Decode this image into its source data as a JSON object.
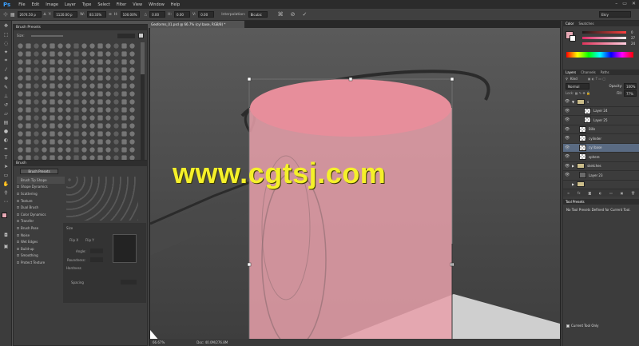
{
  "app": {
    "logo": "Ps"
  },
  "menu": {
    "items": [
      "File",
      "Edit",
      "Image",
      "Layer",
      "Type",
      "Select",
      "Filter",
      "View",
      "Window",
      "Help"
    ]
  },
  "window_controls": [
    "–",
    "▭",
    "✕"
  ],
  "options_bar": {
    "x_value": "2674.50 p",
    "y_label": "Y:",
    "y_value": "1120.00 p",
    "w_label": "W:",
    "w_value": "83.33%",
    "h_label": "H:",
    "h_value": "100.00%",
    "angle_value": "0.00",
    "hskew_label": "H:",
    "hskew_value": "0.00",
    "vskew_label": "V:",
    "vskew_value": "0.00",
    "interp_label": "Interpolation:",
    "interp_value": "Bicubic",
    "workspace": "Ekry"
  },
  "brush_presets": {
    "title": "Brush Presets",
    "size_label": "Size:"
  },
  "brush_panel": {
    "tab": "Brush",
    "presets_button": "Brush Presets",
    "items": [
      "Brush Tip Shape",
      "Shape Dynamics",
      "Scattering",
      "Texture",
      "Dual Brush",
      "Color Dynamics",
      "Transfer",
      "Brush Pose",
      "Noise",
      "Wet Edges",
      "Build-up",
      "Smoothing",
      "Protect Texture"
    ],
    "size_label": "Size",
    "flipx": "Flip X",
    "flipy": "Flip Y",
    "angle": "Angle:",
    "roundness": "Roundness:",
    "hardness": "Hardness",
    "spacing": "Spacing"
  },
  "document": {
    "tab": "Geoforms_01.psd @ 66.7% (cyl base, RGB/8) *",
    "zoom": "66.67%",
    "doc_info": "Doc: 40.0M/276.8M"
  },
  "watermark": "www.cgtsj.com",
  "color_panel": {
    "tabs": [
      "Color",
      "Swatches"
    ],
    "values": [
      "0",
      "27",
      "24"
    ]
  },
  "layers_panel": {
    "tabs": [
      "Layers",
      "Channels",
      "Paths"
    ],
    "kind_label": "Kind",
    "blend_mode": "Normal",
    "opacity_label": "Opacity:",
    "opacity_value": "100%",
    "fill_label": "Fill:",
    "fill_value": "77%",
    "layers": [
      {
        "name": "s",
        "type": "group"
      },
      {
        "name": "Layer 24",
        "type": "layer"
      },
      {
        "name": "Layer 25",
        "type": "layer"
      },
      {
        "name": "Bills",
        "type": "layer"
      },
      {
        "name": "cylinder",
        "type": "layer"
      },
      {
        "name": "cyl base",
        "type": "layer",
        "selected": true
      },
      {
        "name": "sphere",
        "type": "layer"
      },
      {
        "name": "sketches",
        "type": "group"
      },
      {
        "name": "Layer 23",
        "type": "layer"
      }
    ]
  },
  "tool_presets": {
    "title": "Tool Presets",
    "empty_text": "No Tool Presets Defined for Current Tool.",
    "current_only": "Current Tool Only"
  },
  "colors": {
    "accent": "#3aa0ff",
    "pink": "#e7a9b5",
    "watermark": "#f5f02a",
    "selected_layer": "#5a6b83"
  }
}
